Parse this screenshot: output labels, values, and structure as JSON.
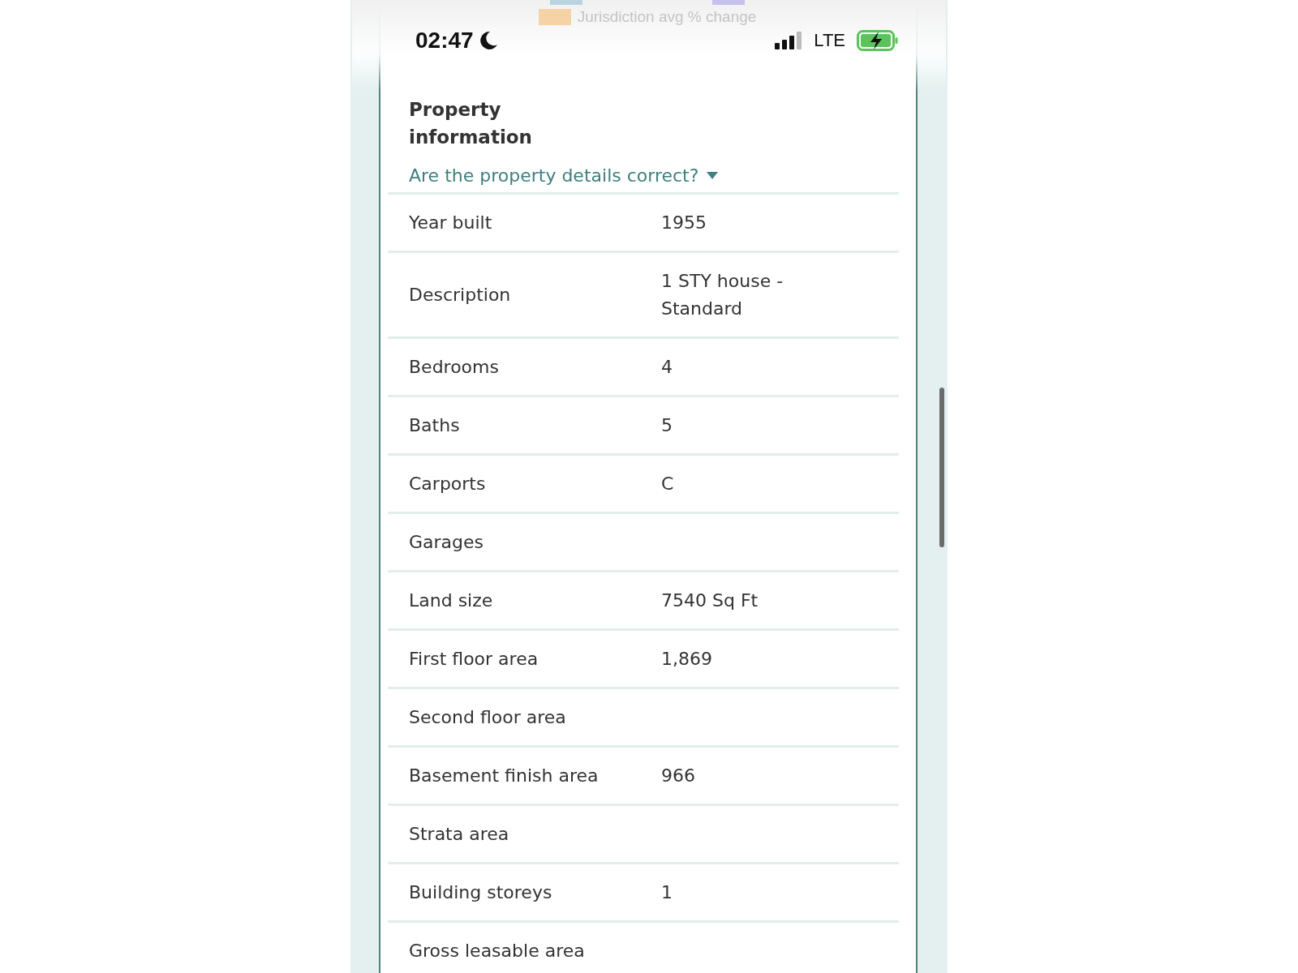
{
  "legend": [
    {
      "color": "#b9d3df"
    },
    {
      "color": "#c6c0ee"
    },
    {
      "color": "#f5d3a6",
      "label": "Jurisdiction avg % change"
    }
  ],
  "status_bar": {
    "time": "02:47",
    "network": "LTE"
  },
  "section": {
    "title": "Property information",
    "link": "Are the property details correct?"
  },
  "rows": [
    {
      "label": "Year built",
      "value": "1955"
    },
    {
      "label": "Description",
      "value": "1 STY house - Standard"
    },
    {
      "label": "Bedrooms",
      "value": "4"
    },
    {
      "label": "Baths",
      "value": "5"
    },
    {
      "label": "Carports",
      "value": "C"
    },
    {
      "label": "Garages"
    },
    {
      "label": "Land size",
      "value": "7540 Sq Ft"
    },
    {
      "label": "First floor area",
      "value": "1,869"
    },
    {
      "label": "Second floor area"
    },
    {
      "label": "Basement finish area",
      "value": "966"
    },
    {
      "label": "Strata area"
    },
    {
      "label": "Building storeys",
      "value": "1"
    },
    {
      "label": "Gross leasable area"
    }
  ]
}
